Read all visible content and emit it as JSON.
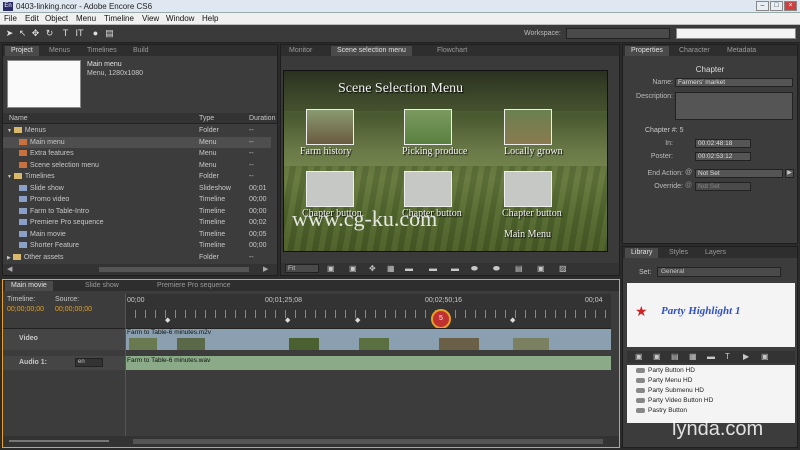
{
  "window": {
    "title": "0403-linking.ncor - Adobe Encore CS6",
    "app_icon": "En"
  },
  "menu": [
    "File",
    "Edit",
    "Object",
    "Menu",
    "Timeline",
    "View",
    "Window",
    "Help"
  ],
  "workspace": {
    "label": "Workspace:",
    "value": ""
  },
  "search": {
    "placeholder": ""
  },
  "project_panel": {
    "tabs": [
      "Project",
      "Menus",
      "Timelines",
      "Build"
    ],
    "preview": {
      "name": "Main menu",
      "info": "Menu, 1280x1080"
    },
    "columns": [
      "Name",
      "Type",
      "Duration"
    ],
    "rows": [
      {
        "name": "Menus",
        "type": "Folder",
        "duration": "--"
      },
      {
        "name": "Main menu",
        "type": "Menu",
        "duration": "--"
      },
      {
        "name": "Extra features",
        "type": "Menu",
        "duration": "--"
      },
      {
        "name": "Scene selection menu",
        "type": "Menu",
        "duration": "--"
      },
      {
        "name": "Timelines",
        "type": "Folder",
        "duration": "--"
      },
      {
        "name": "Slide show",
        "type": "Slideshow",
        "duration": "00;01"
      },
      {
        "name": "Promo video",
        "type": "Timeline",
        "duration": "00;00"
      },
      {
        "name": "Farm to Table-Intro",
        "type": "Timeline",
        "duration": "00;00"
      },
      {
        "name": "Premiere Pro sequence",
        "type": "Timeline",
        "duration": "00;02"
      },
      {
        "name": "Main movie",
        "type": "Timeline",
        "duration": "00;05"
      },
      {
        "name": "Shorter Feature",
        "type": "Timeline",
        "duration": "00;00"
      },
      {
        "name": "Other assets",
        "type": "Folder",
        "duration": "--"
      }
    ]
  },
  "monitor": {
    "tabs": [
      "Monitor",
      "Scene selection menu",
      "Flowchart"
    ],
    "menu_title": "Scene Selection Menu",
    "buttons": [
      "Farm history",
      "Picking produce",
      "Locally grown",
      "Chapter button",
      "Chapter button",
      "Chapter button"
    ],
    "main_menu_link": "Main Menu",
    "watermark": "www.cg-ku.com",
    "fit": "Fit"
  },
  "properties": {
    "tabs": [
      "Properties",
      "Character",
      "Metadata"
    ],
    "heading": "Chapter",
    "name_label": "Name:",
    "name_value": "Farmers' market",
    "description_label": "Description:",
    "chapter_number": "Chapter #: 5",
    "in_label": "In:",
    "in_value": "00:02:48:18",
    "poster_label": "Poster:",
    "poster_value": "00:02:53:12",
    "end_action_label": "End Action:",
    "end_action_value": "Not Set",
    "override_label": "Override:",
    "override_value": "Not Set"
  },
  "library": {
    "tabs": [
      "Library",
      "Styles",
      "Layers"
    ],
    "set_label": "Set:",
    "set_value": "General",
    "preview_text": "Party Highlight 1",
    "items": [
      "Party Button HD",
      "Party Menu HD",
      "Party Submenu HD",
      "Party Video Button HD",
      "Pastry Button"
    ]
  },
  "timeline": {
    "tabs": [
      "Main movie",
      "Slide show",
      "Premiere Pro sequence"
    ],
    "timeline_label": "Timeline:",
    "source_label": "Source:",
    "timeline_tc": "00;00;00;00",
    "source_tc": "00;00;00;00",
    "ruler": [
      "00;00",
      "00;01;25;08",
      "00;02;50;16",
      "00;04"
    ],
    "video_track": "Video",
    "video_clip": "Farm to Table-6 minutes.m2v",
    "audio_track": "Audio 1:",
    "audio_lang": "en",
    "audio_clip": "Farm to Table-6 minutes.wav",
    "highlighted_marker": "5"
  },
  "watermark_brand": "lynda.com",
  "colors": {
    "accent": "#e8a020",
    "playhead": "#d02020",
    "star": "#d02020",
    "library_text": "#3050c8"
  }
}
